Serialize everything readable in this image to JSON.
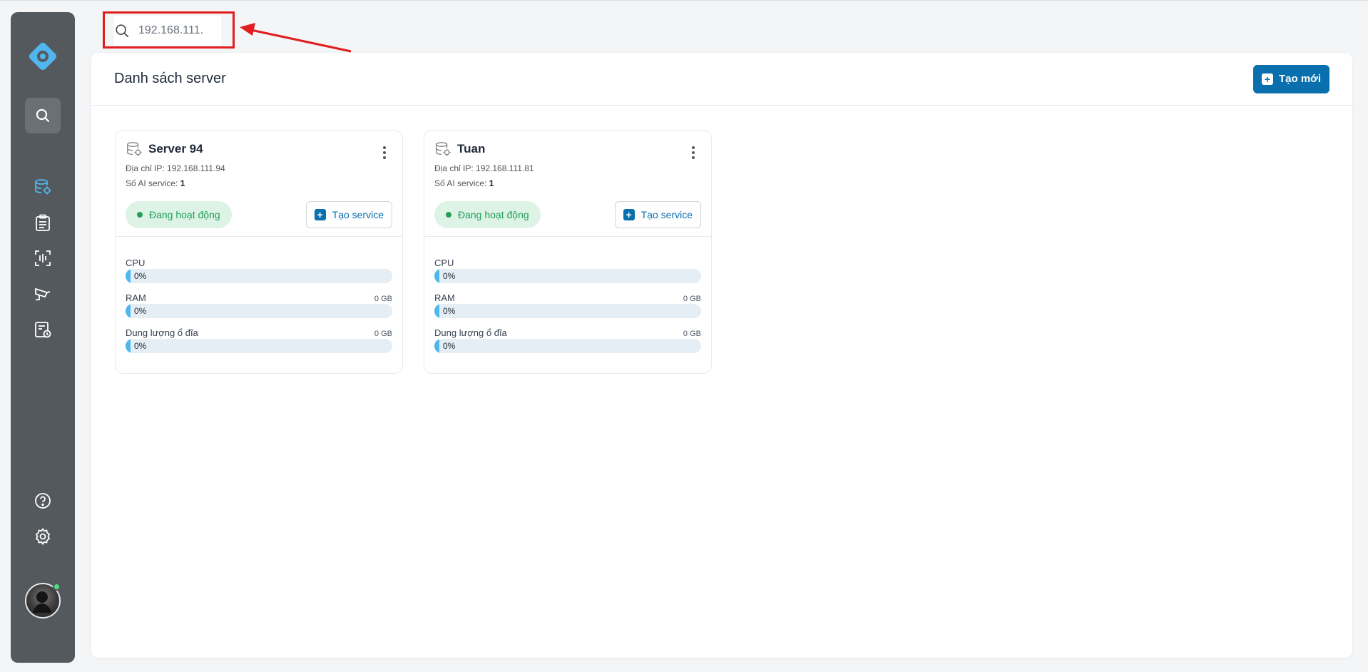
{
  "search": {
    "value": "192.168.111."
  },
  "nav": {
    "items": [
      {
        "name": "servers-icon"
      },
      {
        "name": "clipboard-icon"
      },
      {
        "name": "scan-icon"
      },
      {
        "name": "camera-icon"
      },
      {
        "name": "report-icon"
      }
    ],
    "bottom": [
      {
        "name": "help-icon"
      },
      {
        "name": "settings-icon"
      }
    ]
  },
  "colors": {
    "sidebar": "#54595e",
    "accent": "#0a6fad",
    "status_green": "#22a05a",
    "annotation_red": "#e11d1d"
  },
  "page": {
    "title": "Danh sách server",
    "create_button": "Tạo mới"
  },
  "servers": [
    {
      "name": "Server 94",
      "ip_label": "Địa chỉ IP:",
      "ip": "192.168.111.94",
      "ai_label": "Số AI service:",
      "ai_count": "1",
      "status": "Đang hoạt động",
      "create_service": "Tạo service",
      "metrics": [
        {
          "label": "CPU",
          "value": "",
          "percent": "0%"
        },
        {
          "label": "RAM",
          "value": "0 GB",
          "percent": "0%"
        },
        {
          "label": "Dung lượng ổ đĩa",
          "value": "0 GB",
          "percent": "0%"
        }
      ]
    },
    {
      "name": "Tuan",
      "ip_label": "Địa chỉ IP:",
      "ip": "192.168.111.81",
      "ai_label": "Số AI service:",
      "ai_count": "1",
      "status": "Đang hoạt động",
      "create_service": "Tạo service",
      "metrics": [
        {
          "label": "CPU",
          "value": "",
          "percent": "0%"
        },
        {
          "label": "RAM",
          "value": "0 GB",
          "percent": "0%"
        },
        {
          "label": "Dung lượng ổ đĩa",
          "value": "0 GB",
          "percent": "0%"
        }
      ]
    }
  ]
}
